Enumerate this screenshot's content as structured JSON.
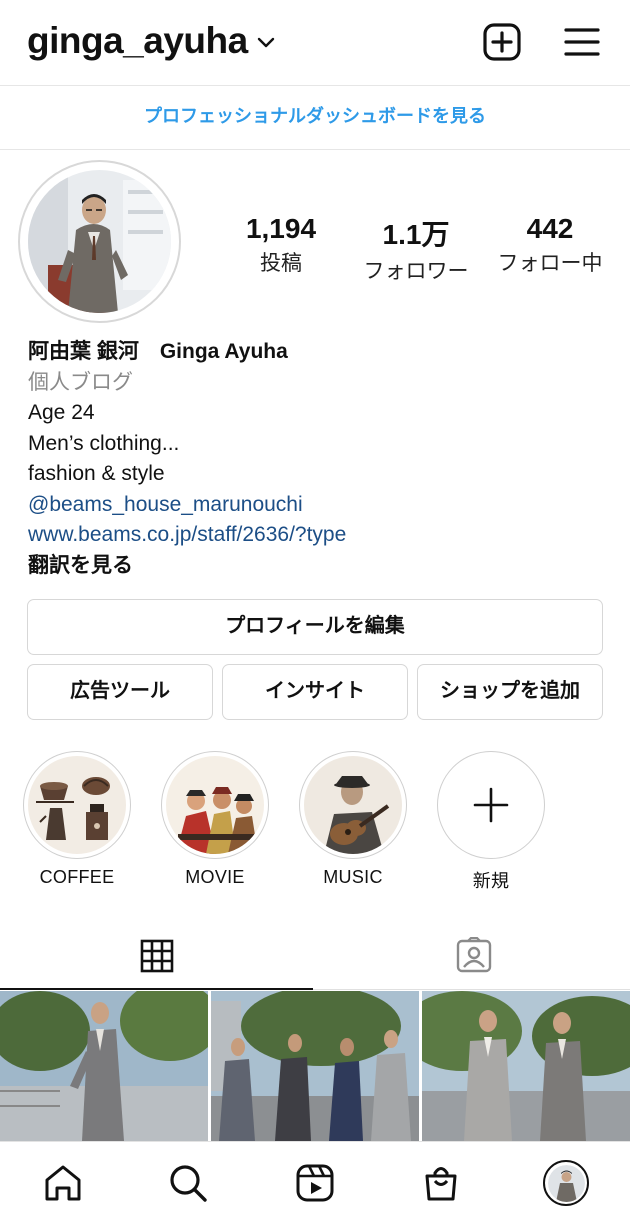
{
  "header": {
    "username": "ginga_ayuha",
    "new_post_icon": "plus-square-icon",
    "menu_icon": "hamburger-menu-icon"
  },
  "dashboard_link": "プロフェッショナルダッシュボードを見る",
  "stats": [
    {
      "value": "1,194",
      "label": "投稿"
    },
    {
      "value": "1.1万",
      "label": "フォロワー"
    },
    {
      "value": "442",
      "label": "フォロー中"
    }
  ],
  "bio": {
    "name": "阿由葉 銀河　Ginga Ayuha",
    "category": "個人ブログ",
    "lines": [
      "Age 24",
      "Men’s clothing...",
      "fashion & style"
    ],
    "mention": "@beams_house_marunouchi",
    "website": "www.beams.co.jp/staff/2636/?type",
    "translate": "翻訳を見る"
  },
  "buttons": {
    "edit_profile": "プロフィールを編集",
    "ad_tools": "広告ツール",
    "insights": "インサイト",
    "add_shop": "ショップを追加"
  },
  "highlights": [
    {
      "label": "COFFEE"
    },
    {
      "label": "MOVIE"
    },
    {
      "label": "MUSIC"
    },
    {
      "label": "新規"
    }
  ],
  "tabs": [
    {
      "icon": "grid-icon",
      "active": true
    },
    {
      "icon": "tagged-person-icon",
      "active": false
    }
  ],
  "bottom_nav": [
    "home-icon",
    "search-icon",
    "reels-icon",
    "shop-bag-icon",
    "profile-avatar"
  ],
  "colors": {
    "link_blue": "#2e9ae8",
    "bio_link": "#1c4e86",
    "border": "#d7d7d7"
  }
}
